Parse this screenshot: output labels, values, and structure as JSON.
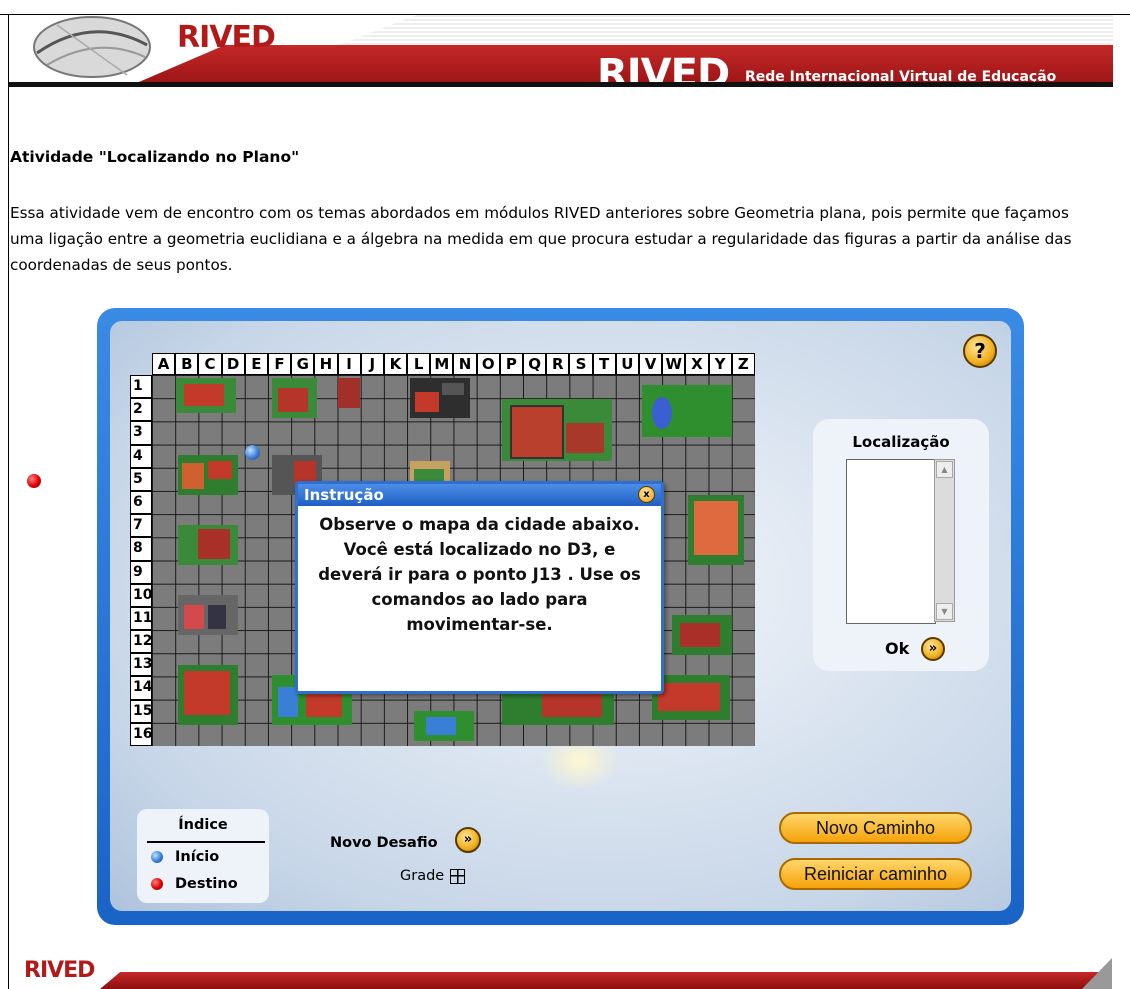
{
  "header": {
    "logo_small": "RIVED",
    "logo_big": "RIVED",
    "logo_subtitle": "Rede Internacional Virtual de Educação"
  },
  "article": {
    "heading": "Atividade \"Localizando no Plano\"",
    "intro": "Essa atividade vem de encontro com os temas abordados em módulos RIVED anteriores sobre Geometria plana, pois permite que façamos uma ligação entre a geometria euclidiana e a álgebra na medida em que procura estudar a regularidade das figuras a partir da análise das coordenadas de seus pontos."
  },
  "app": {
    "help_label": "?",
    "map": {
      "columns": [
        "A",
        "B",
        "C",
        "D",
        "E",
        "F",
        "G",
        "H",
        "I",
        "J",
        "K",
        "L",
        "M",
        "N",
        "O",
        "P",
        "Q",
        "R",
        "S",
        "T",
        "U",
        "V",
        "W",
        "X",
        "Y",
        "Z"
      ],
      "rows": [
        "1",
        "2",
        "3",
        "4",
        "5",
        "6",
        "7",
        "8",
        "9",
        "10",
        "11",
        "12",
        "13",
        "14",
        "15",
        "16"
      ]
    },
    "dialog": {
      "title": "Instrução",
      "close": "x",
      "text": "Observe o mapa da cidade abaixo. Você está localizado no D3, e deverá ir para o ponto J13 . Use os comandos ao lado para movimentar-se."
    },
    "location": {
      "title": "Localização",
      "ok_label": "Ok",
      "ok_icon": "»"
    },
    "legend": {
      "title": "Índice",
      "start_label": "Início",
      "destination_label": "Destino"
    },
    "controls": {
      "novo_desafio_label": "Novo Desafio",
      "novo_desafio_icon": "»",
      "grade_label": "Grade",
      "novo_caminho_label": "Novo Caminho",
      "reiniciar_label": "Reiniciar caminho"
    },
    "colors": {
      "frame_blue": "#1a63c6",
      "button_orange": "#f5a20a",
      "brand_red": "#b21a1a"
    }
  },
  "footer": {
    "logo": "RIVED"
  }
}
